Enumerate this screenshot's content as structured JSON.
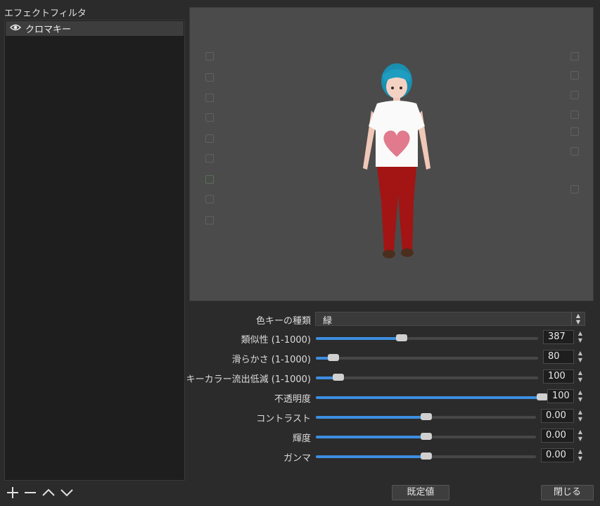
{
  "panel": {
    "title": "エフェクトフィルタ"
  },
  "filters": [
    {
      "label": "クロマキー",
      "visible": true
    }
  ],
  "settings": {
    "key_color_type": {
      "label": "色キーの種類",
      "value": "緑"
    },
    "similarity": {
      "label": "類似性 (1-1000)",
      "value": "387",
      "level": 0.387
    },
    "smoothness": {
      "label": "滑らかさ (1-1000)",
      "value": "80",
      "level": 0.08
    },
    "spill": {
      "label": "キーカラー流出低減 (1-1000)",
      "value": "100",
      "level": 0.1
    },
    "opacity": {
      "label": "不透明度",
      "value": "100",
      "level": 1.0
    },
    "contrast": {
      "label": "コントラスト",
      "value": "0.00",
      "level": 0.5
    },
    "brightness": {
      "label": "輝度",
      "value": "0.00",
      "level": 0.5
    },
    "gamma": {
      "label": "ガンマ",
      "value": "0.00",
      "level": 0.5
    }
  },
  "buttons": {
    "defaults": "既定値",
    "close": "閉じる"
  },
  "colors": {
    "accent": "#3d8ee0",
    "background": "#2b2b2b",
    "preview": "#4b4b4b"
  },
  "icons": [
    "eye-icon",
    "plus-icon",
    "minus-icon",
    "chevron-up-icon",
    "chevron-down-icon"
  ]
}
